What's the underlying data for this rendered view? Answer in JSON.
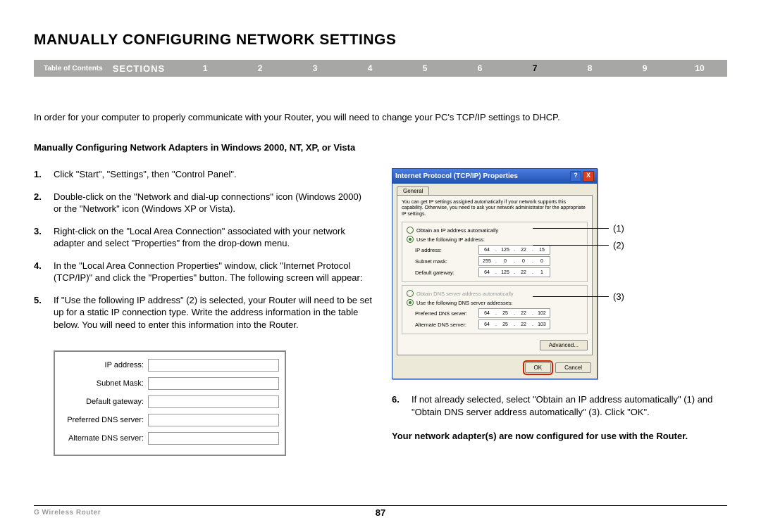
{
  "title": "Manually Configuring Network Settings",
  "nav": {
    "toc": "Table of Contents",
    "sections_label": "SECTIONS",
    "items": [
      "1",
      "2",
      "3",
      "4",
      "5",
      "6",
      "7",
      "8",
      "9",
      "10"
    ],
    "active": "7"
  },
  "intro": "In order for your computer to properly communicate with your Router, you will need to change your PC's TCP/IP settings to DHCP.",
  "subheading": "Manually Configuring Network Adapters in Windows 2000, NT, XP, or Vista",
  "steps": [
    "Click \"Start\", \"Settings\", then \"Control Panel\".",
    "Double-click on the \"Network and dial-up connections\" icon (Windows 2000) or the \"Network\" icon (Windows XP or Vista).",
    "Right-click on the \"Local Area Connection\" associated with your network adapter and select \"Properties\" from the drop-down menu.",
    "In the \"Local Area Connection Properties\" window, click \"Internet Protocol (TCP/IP)\" and click the \"Properties\" button. The following screen will appear:",
    "If \"Use the following IP address\" (2) is selected, your Router will need to be set up for a static IP connection type. Write the address information in the table below. You will need to enter this information into the Router."
  ],
  "step6": {
    "num": "6.",
    "text": "If not already selected, select \"Obtain an IP address automatically\" (1) and \"Obtain DNS server address automatically\" (3). Click \"OK\"."
  },
  "conclude": "Your network adapter(s) are now configured for use with the Router.",
  "ip_table_labels": [
    "IP address:",
    "Subnet Mask:",
    "Default gateway:",
    "Preferred DNS server:",
    "Alternate DNS server:"
  ],
  "dialog": {
    "title": "Internet Protocol (TCP/IP) Properties",
    "tab": "General",
    "blurb": "You can get IP settings assigned automatically if your network supports this capability. Otherwise, you need to ask your network administrator for the appropriate IP settings.",
    "radio_auto_ip": "Obtain an IP address automatically",
    "radio_use_ip": "Use the following IP address:",
    "ip_address_label": "IP address:",
    "ip_address": [
      "64",
      "125",
      "22",
      "15"
    ],
    "subnet_label": "Subnet mask:",
    "subnet": [
      "255",
      "0",
      "0",
      "0"
    ],
    "gateway_label": "Default gateway:",
    "gateway": [
      "64",
      "125",
      "22",
      "1"
    ],
    "radio_auto_dns": "Obtain DNS server address automatically",
    "radio_use_dns": "Use the following DNS server addresses:",
    "pref_dns_label": "Preferred DNS server:",
    "pref_dns": [
      "64",
      "25",
      "22",
      "102"
    ],
    "alt_dns_label": "Alternate DNS server:",
    "alt_dns": [
      "64",
      "25",
      "22",
      "103"
    ],
    "advanced": "Advanced...",
    "ok": "OK",
    "cancel": "Cancel",
    "help_icon": "?",
    "close_icon": "X"
  },
  "callouts": {
    "c1": "(1)",
    "c2": "(2)",
    "c3": "(3)"
  },
  "footer": {
    "product": "G Wireless Router",
    "page": "87"
  }
}
